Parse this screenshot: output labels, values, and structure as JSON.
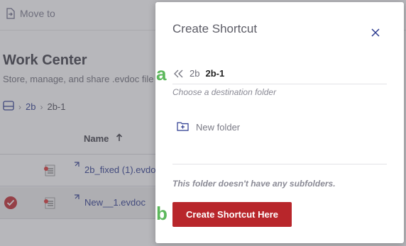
{
  "background": {
    "toolbar": {
      "move_to_label": "Move to",
      "move_to_icon": "move-file-icon"
    },
    "title": "Work Center",
    "subtitle": "Store, manage, and share .evdoc file",
    "breadcrumb": {
      "root_icon": "drive-icon",
      "items": [
        "2b",
        "2b-1"
      ]
    },
    "table": {
      "name_header": "Name",
      "sort_icon": "arrow-up-icon",
      "rows": [
        {
          "name": "2b_fixed (1).evdo",
          "selected": false
        },
        {
          "name": "New__1.evdoc",
          "selected": true
        }
      ]
    }
  },
  "modal": {
    "title": "Create Shortcut",
    "close_icon": "close-icon",
    "annotation_a": "a",
    "annotation_b": "b",
    "breadcrumb": {
      "back_icon": "double-chevron-left-icon",
      "parent": "2b",
      "current": "2b-1"
    },
    "hint": "Choose a destination folder",
    "new_folder_label": "New folder",
    "empty_message": "This folder doesn't have any subfolders.",
    "primary_button": "Create Shortcut Here"
  },
  "colors": {
    "accent_red": "#b8262b",
    "link_blue": "#2b3a8f",
    "annotation_green": "#5cb85c",
    "overlay": "rgba(95,95,105,0.45)"
  }
}
